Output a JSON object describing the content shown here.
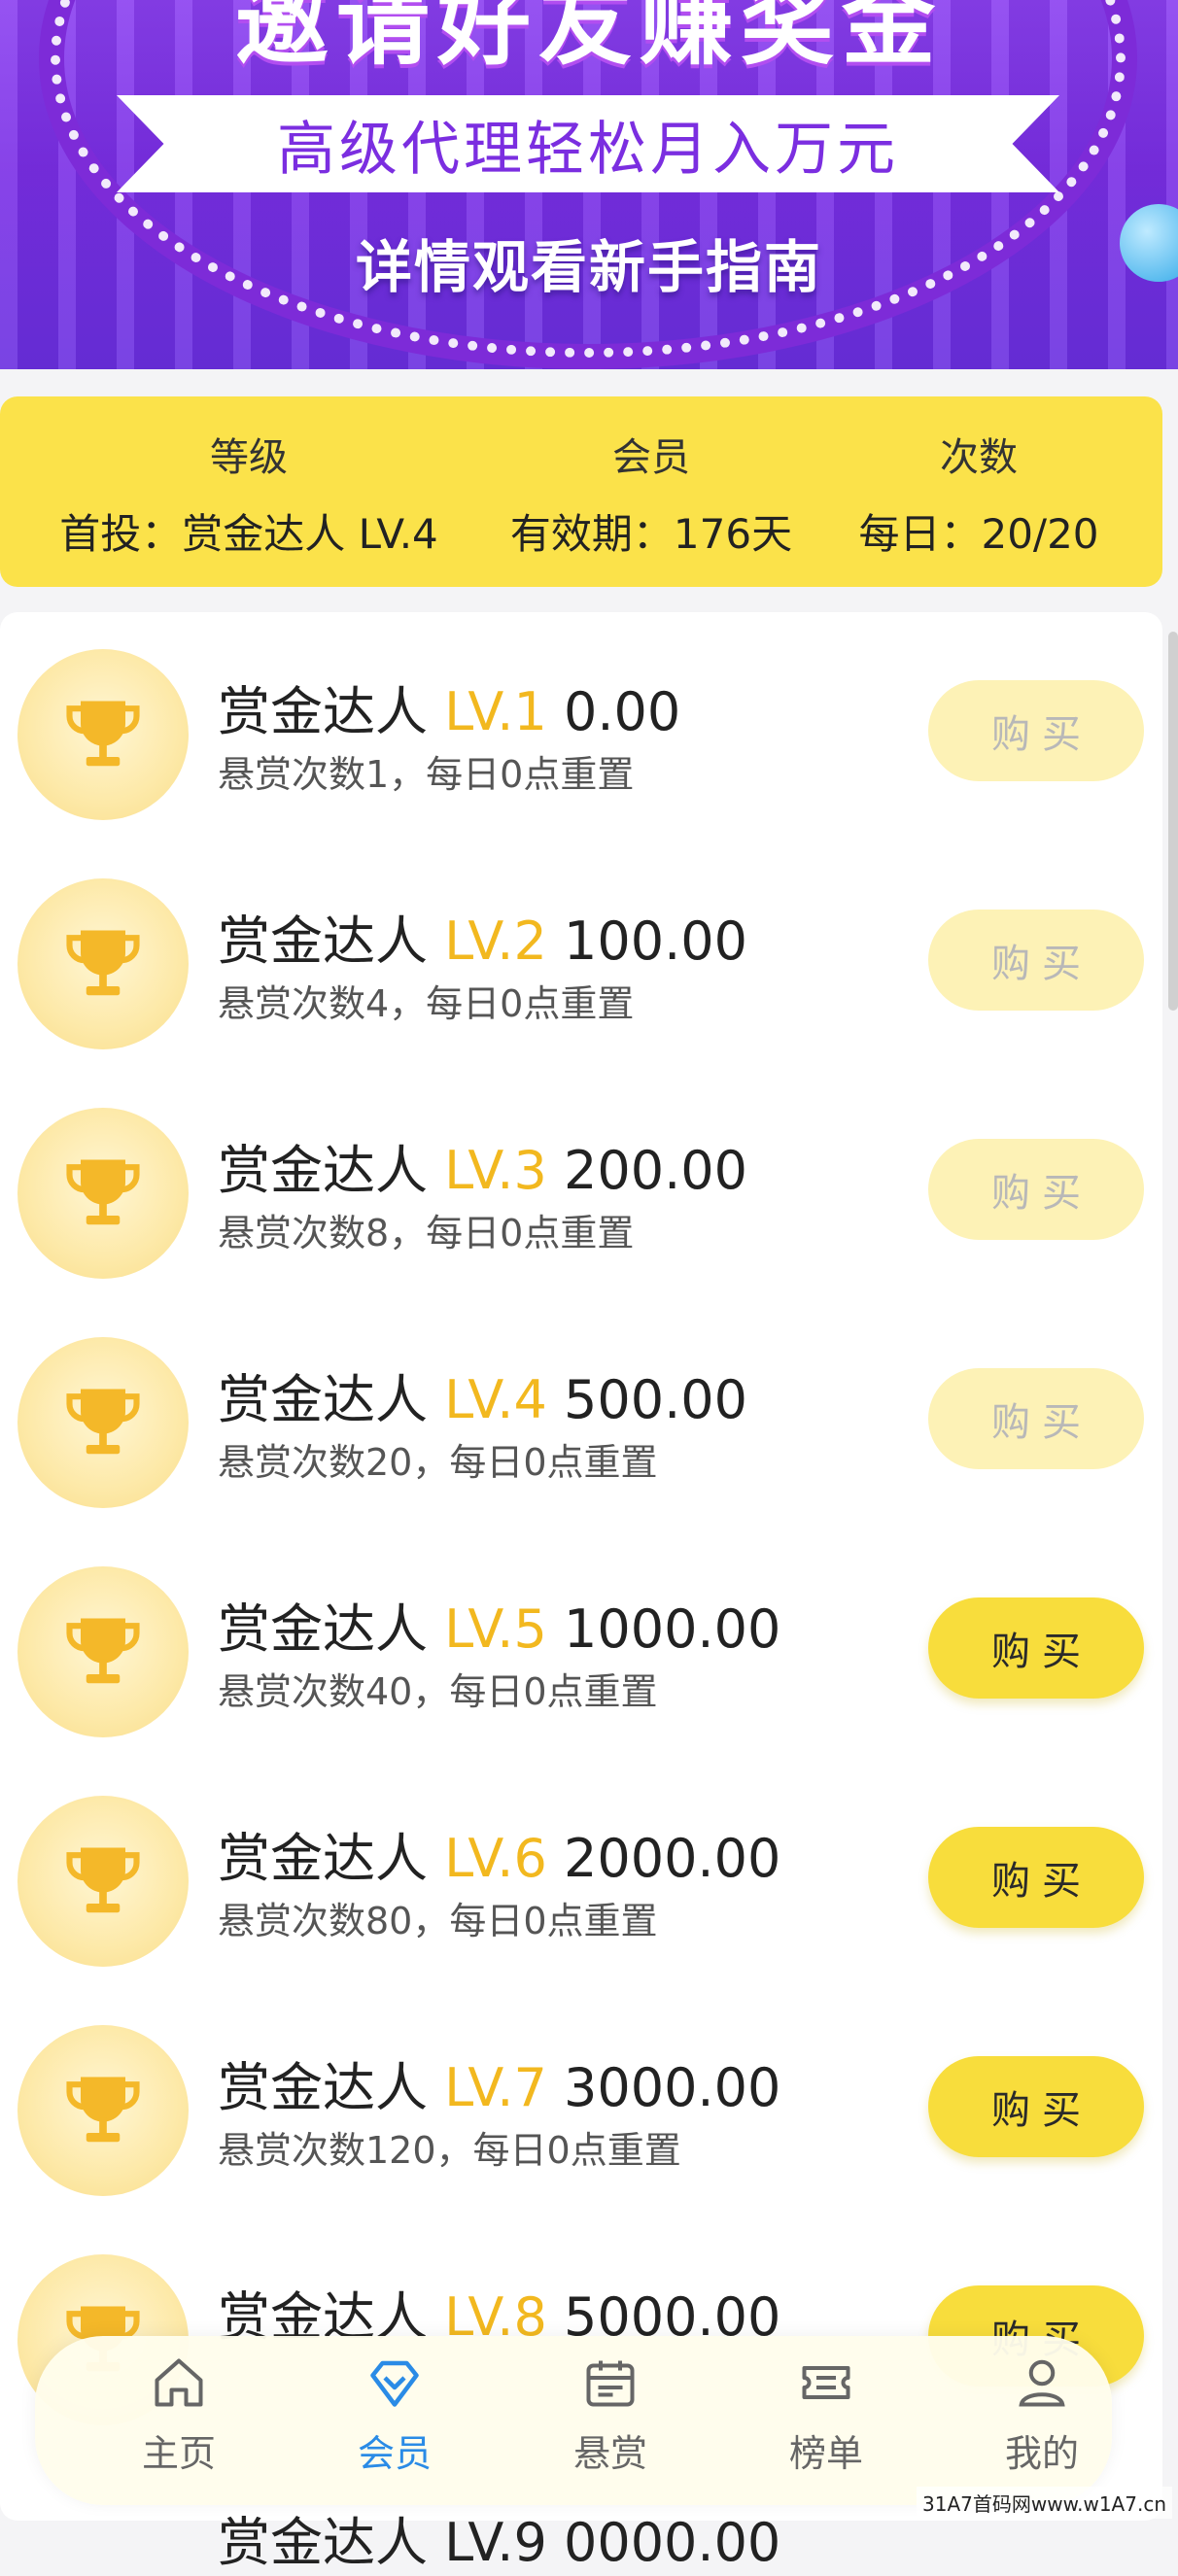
{
  "banner": {
    "top_text": "邀请好友赚奖金",
    "subtitle": "高级代理轻松月入万元",
    "guide_text": "详情观看新手指南"
  },
  "summary": {
    "level": {
      "label": "等级",
      "value": "首投：赏金达人 LV.4"
    },
    "member": {
      "label": "会员",
      "value": "有效期：176天"
    },
    "count": {
      "label": "次数",
      "value": "每日：20/20"
    }
  },
  "tiers": [
    {
      "name": "赏金达人",
      "level": "LV.1",
      "price": "0.00",
      "desc": "悬赏次数1，每日0点重置",
      "button": "购买",
      "enabled": false
    },
    {
      "name": "赏金达人",
      "level": "LV.2",
      "price": "100.00",
      "desc": "悬赏次数4，每日0点重置",
      "button": "购买",
      "enabled": false
    },
    {
      "name": "赏金达人",
      "level": "LV.3",
      "price": "200.00",
      "desc": "悬赏次数8，每日0点重置",
      "button": "购买",
      "enabled": false
    },
    {
      "name": "赏金达人",
      "level": "LV.4",
      "price": "500.00",
      "desc": "悬赏次数20，每日0点重置",
      "button": "购买",
      "enabled": false
    },
    {
      "name": "赏金达人",
      "level": "LV.5",
      "price": "1000.00",
      "desc": "悬赏次数40，每日0点重置",
      "button": "购买",
      "enabled": true
    },
    {
      "name": "赏金达人",
      "level": "LV.6",
      "price": "2000.00",
      "desc": "悬赏次数80，每日0点重置",
      "button": "购买",
      "enabled": true
    },
    {
      "name": "赏金达人",
      "level": "LV.7",
      "price": "3000.00",
      "desc": "悬赏次数120，每日0点重置",
      "button": "购买",
      "enabled": true
    },
    {
      "name": "赏金达人",
      "level": "LV.8",
      "price": "5000.00",
      "desc": "",
      "button": "购买",
      "enabled": true
    }
  ],
  "nav": [
    {
      "label": "主页",
      "icon": "home-icon",
      "active": false
    },
    {
      "label": "会员",
      "icon": "diamond-icon",
      "active": true
    },
    {
      "label": "悬赏",
      "icon": "calendar-icon",
      "active": false
    },
    {
      "label": "榜单",
      "icon": "ticket-icon",
      "active": false
    },
    {
      "label": "我的",
      "icon": "user-icon",
      "active": false
    }
  ],
  "watermark": "31A7首码网www.w1A7.cn",
  "colors": {
    "accent_yellow": "#f8dd3c",
    "level_gold": "#f2b81f",
    "nav_active": "#2a8be6",
    "banner_purple": "#7a2ee6"
  }
}
